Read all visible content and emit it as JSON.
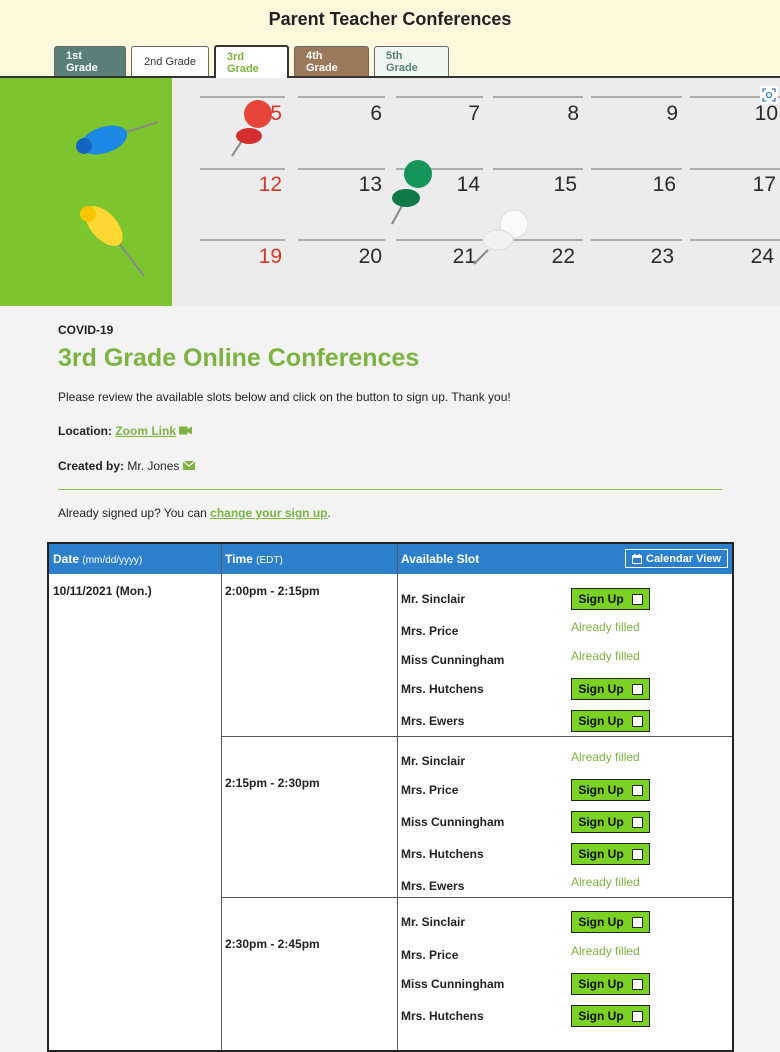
{
  "site": {
    "title": "Parent Teacher Conferences"
  },
  "tabs": [
    "1st Grade",
    "2nd Grade",
    "3rd Grade",
    "4th Grade",
    "5th Grade"
  ],
  "banner": {
    "row1": [
      "5",
      "6",
      "7",
      "8",
      "9",
      "10"
    ],
    "row2": [
      "12",
      "13",
      "14",
      "15",
      "16",
      "17"
    ],
    "row3": [
      "19",
      "20",
      "21",
      "22",
      "23",
      "24"
    ]
  },
  "page": {
    "eyebrow": "COVID-19",
    "title": "3rd Grade Online Conferences",
    "description": "Please review the available slots below and click on the button to sign up. Thank you!",
    "location_label": "Location:",
    "location_link": "Zoom Link",
    "created_label": "Created by:",
    "created_name": "Mr. Jones",
    "already_text": "Already signed up? You can",
    "change_link": "change your sign up",
    "already_end": "."
  },
  "table": {
    "col_date": "Date",
    "col_date_hint": "(mm/dd/yyyy)",
    "col_time": "Time",
    "col_time_hint": "(EDT)",
    "col_slot": "Available Slot",
    "calendar_view": "Calendar View",
    "date": "10/11/2021 (Mon.)",
    "signup_label": "Sign Up",
    "filled_label": "Already filled",
    "blocks": [
      {
        "time": "2:00pm - 2:15pm",
        "slots": [
          {
            "name": "Mr. Sinclair",
            "status": "open"
          },
          {
            "name": "Mrs. Price",
            "status": "filled"
          },
          {
            "name": "Miss Cunningham",
            "status": "filled"
          },
          {
            "name": "Mrs. Hutchens",
            "status": "open"
          },
          {
            "name": "Mrs. Ewers",
            "status": "open"
          }
        ]
      },
      {
        "time": "2:15pm - 2:30pm",
        "slots": [
          {
            "name": "Mr. Sinclair",
            "status": "filled"
          },
          {
            "name": "Mrs. Price",
            "status": "open"
          },
          {
            "name": "Miss Cunningham",
            "status": "open"
          },
          {
            "name": "Mrs. Hutchens",
            "status": "open"
          },
          {
            "name": "Mrs. Ewers",
            "status": "filled"
          }
        ]
      },
      {
        "time": "2:30pm - 2:45pm",
        "slots": [
          {
            "name": "Mr. Sinclair",
            "status": "open"
          },
          {
            "name": "Mrs. Price",
            "status": "filled"
          },
          {
            "name": "Miss Cunningham",
            "status": "open"
          },
          {
            "name": "Mrs. Hutchens",
            "status": "open"
          }
        ]
      }
    ]
  },
  "colors": {
    "accent": "#7cb342",
    "header_blue": "#2b7fcb",
    "signup_green": "#7cd125"
  }
}
